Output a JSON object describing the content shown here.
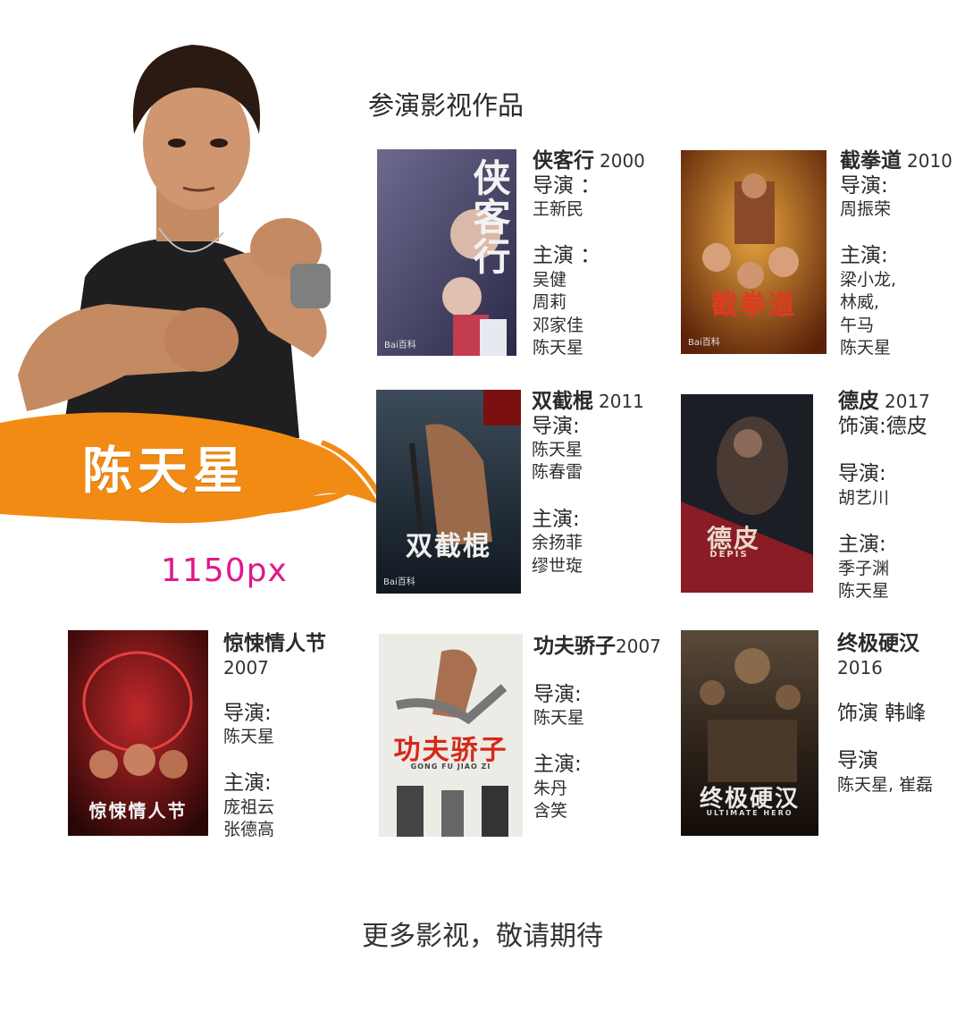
{
  "actor": {
    "name": "陈天星"
  },
  "size_note": "1150px",
  "section_title": "参演影视作品",
  "films": [
    {
      "id": "xiakexing",
      "title": "侠客行",
      "year": "2000",
      "poster_title": "侠客行",
      "lines": [
        {
          "kind": "h",
          "text": "导演 ："
        },
        {
          "kind": "n",
          "text": "王新民"
        },
        {
          "kind": "gap"
        },
        {
          "kind": "h",
          "text": "主演 ："
        },
        {
          "kind": "n",
          "text": "吴健"
        },
        {
          "kind": "n",
          "text": "周莉"
        },
        {
          "kind": "n",
          "text": "邓家佳"
        },
        {
          "kind": "n",
          "text": "陈天星"
        }
      ]
    },
    {
      "id": "jiequandao",
      "title": "截拳道",
      "year": "2010",
      "poster_title": "截拳道",
      "lines": [
        {
          "kind": "h",
          "text": "导演:"
        },
        {
          "kind": "n",
          "text": "周振荣"
        },
        {
          "kind": "gap"
        },
        {
          "kind": "h",
          "text": "主演:"
        },
        {
          "kind": "n",
          "text": "梁小龙,"
        },
        {
          "kind": "n",
          "text": "林威,"
        },
        {
          "kind": "n",
          "text": "午马"
        },
        {
          "kind": "n",
          "text": "陈天星"
        }
      ]
    },
    {
      "id": "shuangjiegun",
      "title": "双截棍",
      "year": "2011",
      "poster_title": "双截棍",
      "lines": [
        {
          "kind": "h",
          "text": "导演:"
        },
        {
          "kind": "n",
          "text": "陈天星"
        },
        {
          "kind": "n",
          "text": "陈春雷"
        },
        {
          "kind": "gap"
        },
        {
          "kind": "h",
          "text": "主演:"
        },
        {
          "kind": "n",
          "text": "余扬菲"
        },
        {
          "kind": "n",
          "text": "缪世琁"
        }
      ]
    },
    {
      "id": "depi",
      "title": "德皮",
      "year": "2017",
      "poster_title": "德皮",
      "poster_sub": "DEPIS",
      "lines": [
        {
          "kind": "h",
          "text": "饰演:德皮"
        },
        {
          "kind": "gap"
        },
        {
          "kind": "h",
          "text": "导演:"
        },
        {
          "kind": "n",
          "text": "胡艺川"
        },
        {
          "kind": "gap"
        },
        {
          "kind": "h",
          "text": "主演:"
        },
        {
          "kind": "n",
          "text": "季子渊"
        },
        {
          "kind": "n",
          "text": "陈天星"
        }
      ]
    },
    {
      "id": "jingsong",
      "title": "惊悚情人节",
      "year": "2007",
      "poster_title": "惊悚情人节",
      "lines": [
        {
          "kind": "gap"
        },
        {
          "kind": "h",
          "text": "导演:"
        },
        {
          "kind": "n",
          "text": "陈天星"
        },
        {
          "kind": "gap"
        },
        {
          "kind": "h",
          "text": "主演:"
        },
        {
          "kind": "n",
          "text": "庞祖云"
        },
        {
          "kind": "n",
          "text": "张德高"
        }
      ]
    },
    {
      "id": "gongfujiaozi",
      "title": "功夫骄子",
      "year": "2007",
      "poster_title": "功夫骄子",
      "poster_sub": "GONG FU JIAO ZI",
      "lines": [
        {
          "kind": "gap"
        },
        {
          "kind": "h",
          "text": "导演:"
        },
        {
          "kind": "n",
          "text": "陈天星"
        },
        {
          "kind": "gap"
        },
        {
          "kind": "h",
          "text": "主演:"
        },
        {
          "kind": "n",
          "text": "朱丹"
        },
        {
          "kind": "n",
          "text": "含笑"
        }
      ]
    },
    {
      "id": "zhongjiyinghan",
      "title": "终极硬汉",
      "year": "2016",
      "poster_title": "终极硬汉",
      "poster_sub": "ULTIMATE HERO",
      "lines": [
        {
          "kind": "gap"
        },
        {
          "kind": "h",
          "text": "饰演 韩峰"
        },
        {
          "kind": "gap"
        },
        {
          "kind": "h",
          "text": "导演"
        },
        {
          "kind": "n",
          "text": "陈天星, 崔磊"
        }
      ]
    }
  ],
  "footer": "更多影视，敬请期待"
}
